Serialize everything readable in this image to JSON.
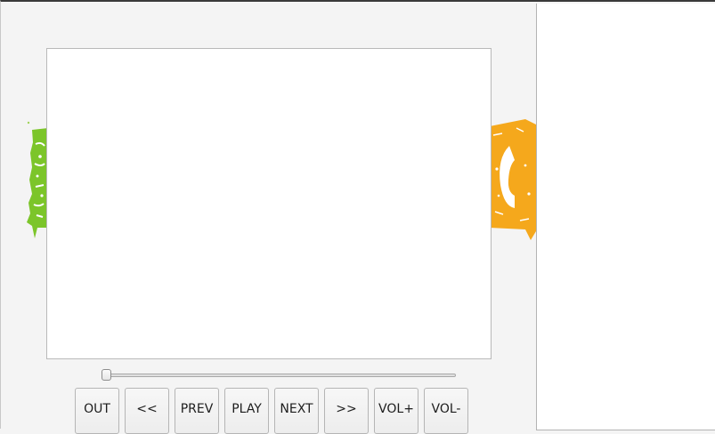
{
  "player": {
    "controls": {
      "out": "OUT",
      "rewind": "<<",
      "prev": "PREV",
      "play": "PLAY",
      "next": "NEXT",
      "forward": ">>",
      "vol_up": "VOL+",
      "vol_down": "VOL-"
    },
    "seek_position": 0.0
  },
  "decor": {
    "left_color": "#7cc52a",
    "right_color": "#f5a81c"
  }
}
